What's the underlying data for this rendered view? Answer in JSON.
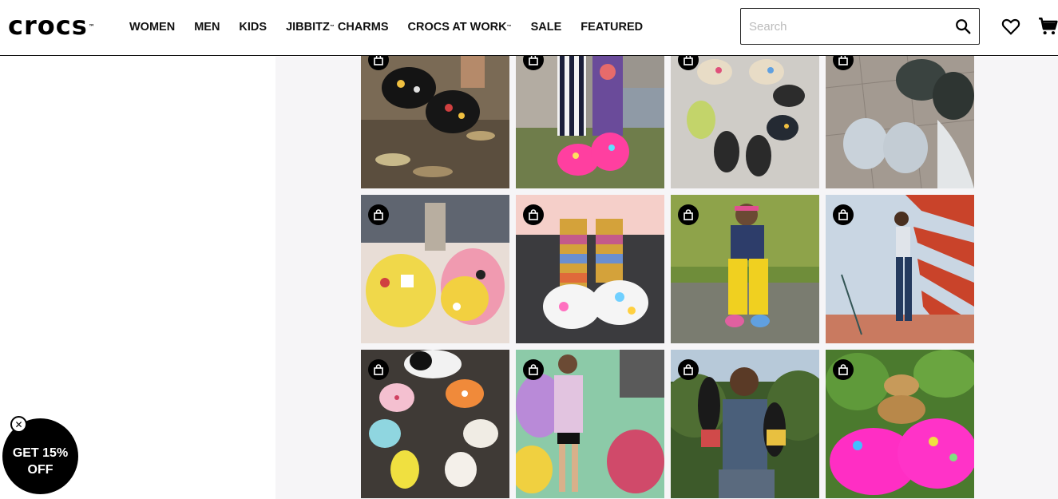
{
  "header": {
    "logo": "crocs",
    "logo_mark": "™",
    "nav": [
      {
        "label": "WOMEN",
        "mark": ""
      },
      {
        "label": "MEN",
        "mark": ""
      },
      {
        "label": "KIDS",
        "mark": ""
      },
      {
        "label": "JIBBITZ",
        "mark": "™",
        "suffix": " CHARMS"
      },
      {
        "label": "CROCS AT WORK",
        "mark": "™",
        "suffix": ""
      },
      {
        "label": "SALE",
        "mark": ""
      },
      {
        "label": "FEATURED",
        "mark": ""
      }
    ],
    "search": {
      "placeholder": "Search",
      "value": ""
    },
    "icons": {
      "search": "search-icon",
      "wishlist": "heart-icon",
      "cart": "cart-icon"
    }
  },
  "gallery": {
    "tiles": [
      {
        "scene": "charms-clogs-on-leaves",
        "icon": "shopping-bag-icon"
      },
      {
        "scene": "striped-legs-pink-clogs",
        "icon": "shopping-bag-icon"
      },
      {
        "scene": "sandals-circle-on-concrete",
        "icon": "shopping-bag-icon"
      },
      {
        "scene": "grey-clogs-on-pavers",
        "icon": "shopping-bag-icon"
      },
      {
        "scene": "tie-dye-clogs-with-charms",
        "icon": "shopping-bag-icon"
      },
      {
        "scene": "rainbow-socks-white-clogs",
        "icon": "shopping-bag-icon"
      },
      {
        "scene": "man-yellow-pants-on-grass",
        "icon": "shopping-bag-icon"
      },
      {
        "scene": "woman-by-red-striped-wall",
        "icon": "shopping-bag-icon"
      },
      {
        "scene": "clogs-circle-with-cat",
        "icon": "shopping-bag-icon"
      },
      {
        "scene": "man-in-front-of-mural",
        "icon": "shopping-bag-icon"
      },
      {
        "scene": "man-holding-slides",
        "icon": "shopping-bag-icon"
      },
      {
        "scene": "lizard-on-pink-clogs",
        "icon": "shopping-bag-icon"
      }
    ]
  },
  "promo": {
    "line1": "GET 15%",
    "line2": "OFF",
    "close_icon": "close-icon"
  },
  "colors": {
    "brand": "#000000",
    "gallery_background": "#f6f5f7"
  }
}
